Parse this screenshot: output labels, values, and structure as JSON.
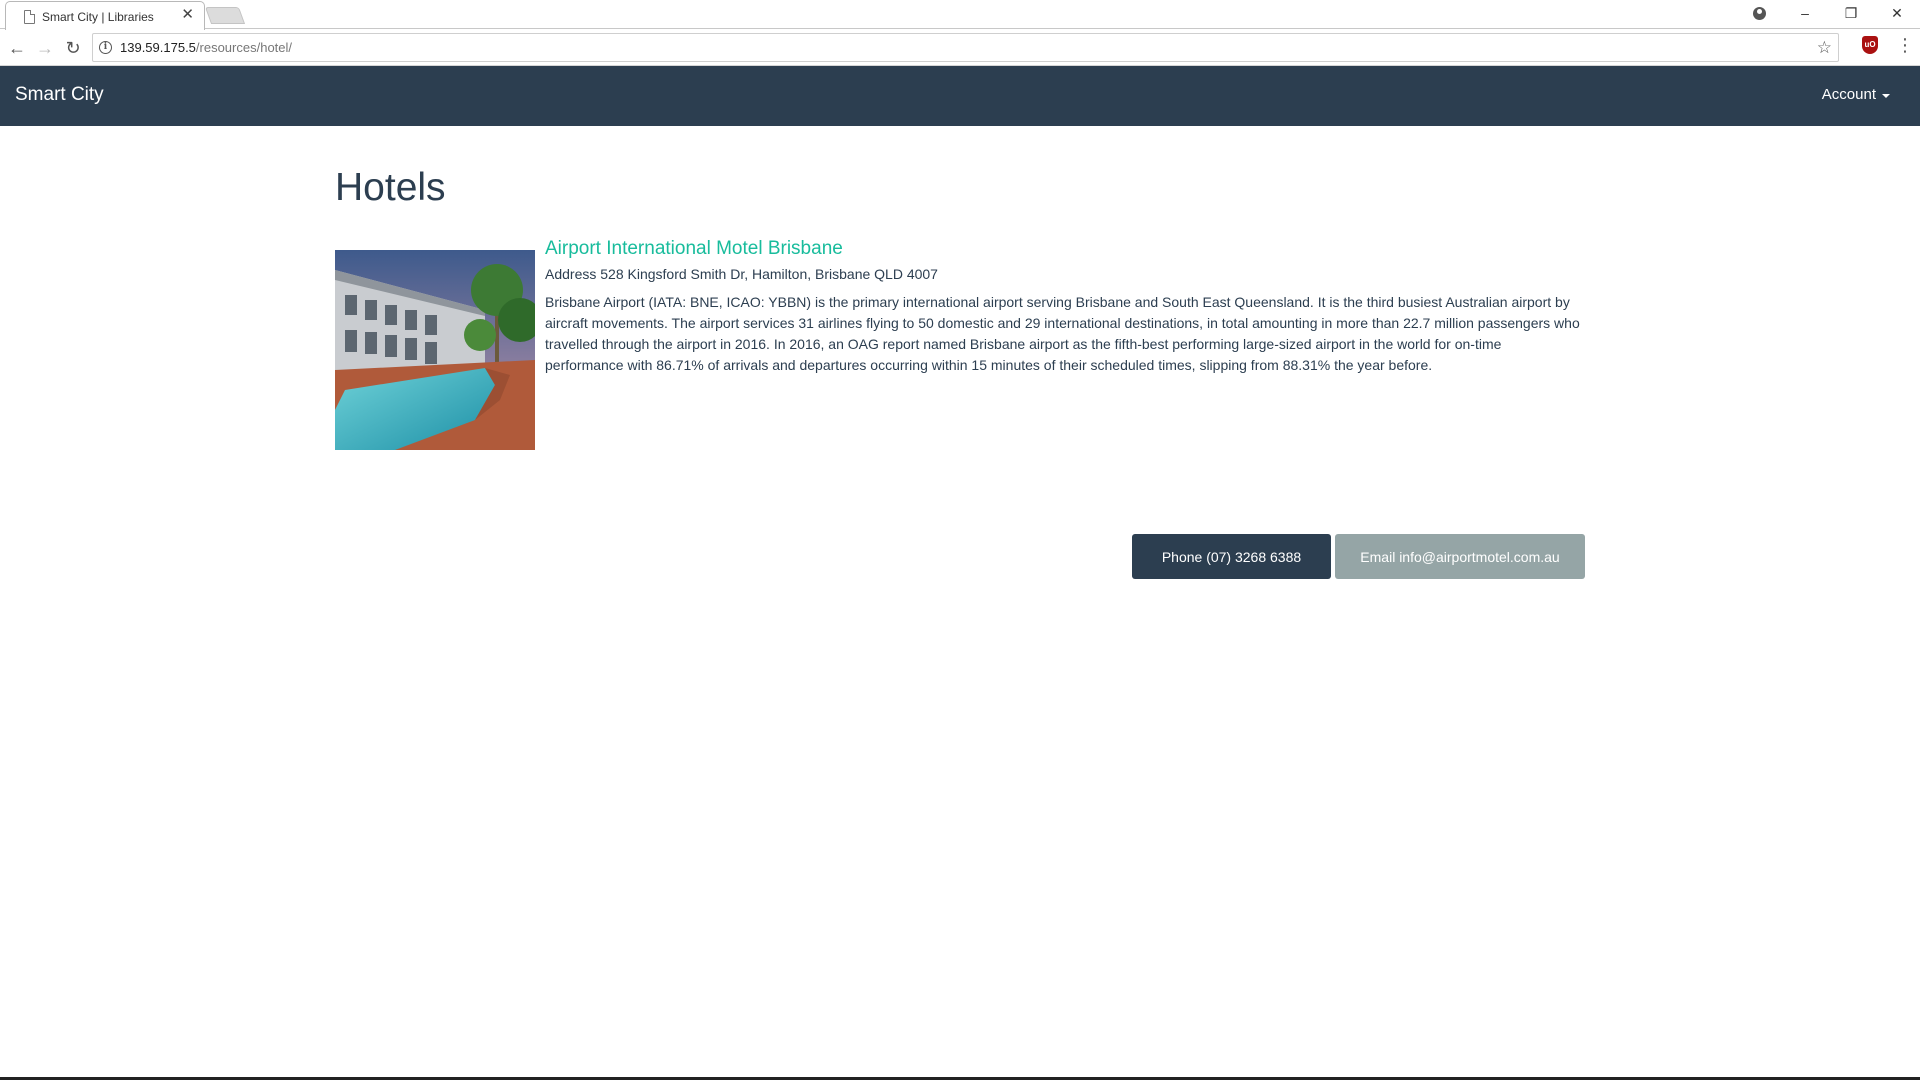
{
  "browser": {
    "tab_title": "Smart City | Libraries",
    "tab_close": "✕",
    "url_host": "139.59.175.5",
    "url_path": "/resources/hotel/",
    "back": "←",
    "forward": "→",
    "reload": "↻",
    "info": "i",
    "star": "☆",
    "menu": "⋮",
    "ext_label": "uO",
    "win_min": "–",
    "win_restore": "❐",
    "win_close": "✕"
  },
  "navbar": {
    "brand": "Smart City",
    "account": "Account"
  },
  "page": {
    "title": "Hotels"
  },
  "hotel": {
    "name": "Airport International Motel Brisbane",
    "address": "Address 528 Kingsford Smith Dr, Hamilton, Brisbane QLD 4007",
    "description": "Brisbane Airport (IATA: BNE, ICAO: YBBN) is the primary international airport serving Brisbane and South East Queensland. It is the third busiest Australian airport by aircraft movements. The airport services 31 airlines flying to 50 domestic and 29 international destinations, in total amounting in more than 22.7 million passengers who travelled through the airport in 2016. In 2016, an OAG report named Brisbane airport as the fifth-best performing large-sized airport in the world for on-time performance with 86.71% of arrivals and departures occurring within 15 minutes of their scheduled times, slipping from 88.31% the year before.",
    "phone_button": "Phone (07) 3268 6388",
    "email_button": "Email info@airportmotel.com.au"
  },
  "colors": {
    "navbar_bg": "#2c3e50",
    "link": "#18bc9c",
    "secondary_button": "#95a5a6"
  }
}
